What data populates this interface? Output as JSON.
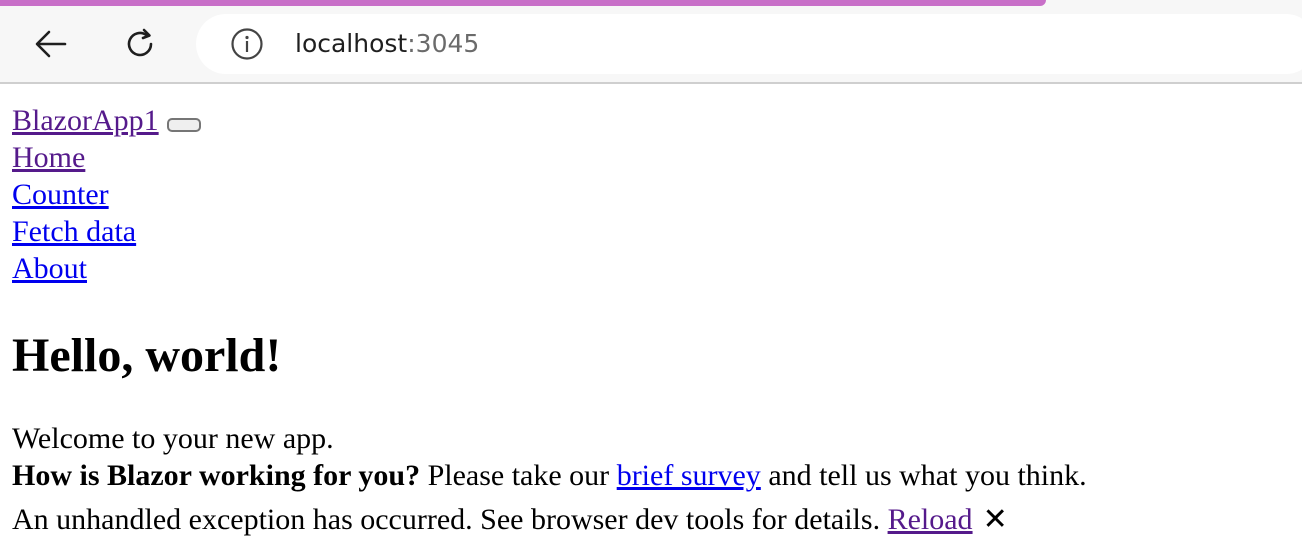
{
  "browser": {
    "url_host": "localhost",
    "url_port": ":3045",
    "back_icon": "arrow-left-icon",
    "reload_icon": "reload-icon",
    "info_icon": "info-icon"
  },
  "navbar": {
    "brand": "BlazorApp1",
    "items": [
      {
        "label": "Home"
      },
      {
        "label": "Counter"
      },
      {
        "label": "Fetch data"
      },
      {
        "label": "About"
      }
    ]
  },
  "main": {
    "heading": "Hello, world!",
    "welcome": "Welcome to your new app.",
    "survey": {
      "prompt": "How is Blazor working for you?",
      "before_link": " Please take our ",
      "link_text": "brief survey",
      "after_link": " and tell us what you think."
    }
  },
  "error_ui": {
    "message": "An unhandled exception has occurred. See browser dev tools for details. ",
    "reload_label": "Reload",
    "dismiss_glyph": "✕"
  },
  "colors": {
    "link": "#0000ee",
    "visited_link": "#551a8b",
    "tab_accent": "#c86fc8"
  }
}
